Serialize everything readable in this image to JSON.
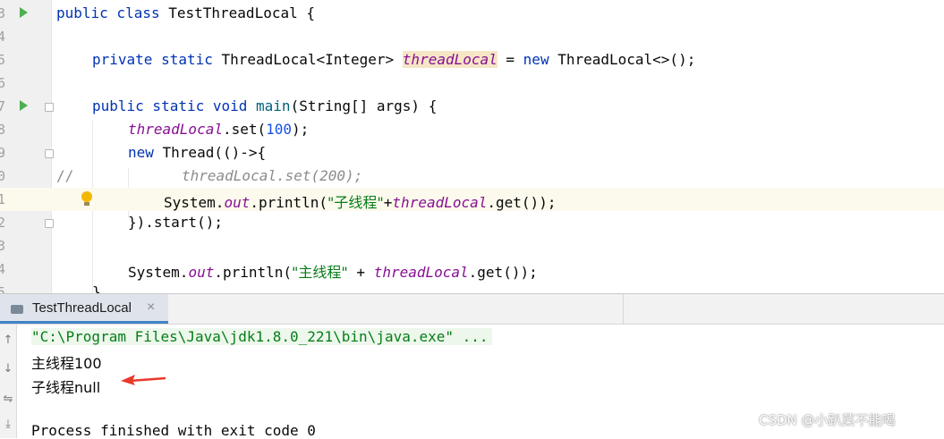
{
  "editor": {
    "lines": [
      {
        "num": "3"
      },
      {
        "num": "4"
      },
      {
        "num": "5"
      },
      {
        "num": "6"
      },
      {
        "num": "7"
      },
      {
        "num": "8"
      },
      {
        "num": "9"
      },
      {
        "num": "0"
      },
      {
        "num": "1"
      },
      {
        "num": "2"
      },
      {
        "num": "3"
      },
      {
        "num": "4"
      },
      {
        "num": "5"
      }
    ],
    "code": {
      "l1_kw": "public class ",
      "l1_rest": "TestThreadLocal {",
      "l3_kw": "private static ",
      "l3_type": "ThreadLocal<Integer> ",
      "l3_field": "threadLocal",
      "l3_eq": " = ",
      "l3_new": "new ",
      "l3_end": "ThreadLocal<>();",
      "l5_kw": "public static void ",
      "l5_fn": "main",
      "l5_rest": "(String[] args) {",
      "l6_field": "threadLocal",
      "l6_mid": ".set(",
      "l6_num": "100",
      "l6_end": ");",
      "l7_new": "new ",
      "l7_rest": "Thread(()->{",
      "l8_slashes": "//",
      "l8_comment": "threadLocal.set(200);",
      "l9_a": "System.",
      "l9_out": "out",
      "l9_b": ".println(",
      "l9_str": "\"子线程\"",
      "l9_plus": "+",
      "l9_field": "threadLocal",
      "l9_end": ".get());",
      "l10": "}).start();",
      "l12_a": "System.",
      "l12_out": "out",
      "l12_b": ".println(",
      "l12_str": "\"主线程\"",
      "l12_plus": " + ",
      "l12_field": "threadLocal",
      "l12_end": ".get());",
      "l13": "}"
    }
  },
  "run_panel": {
    "tab_label": "TestThreadLocal",
    "tab_close": "×",
    "command": "\"C:\\Program Files\\Java\\jdk1.8.0_221\\bin\\java.exe\" ...",
    "out1": "主线程100",
    "out2": "子线程null",
    "exit": "Process finished with exit code 0",
    "icons": [
      "arrow-up-icon",
      "arrow-down-icon",
      "wrap-icon",
      "scroll-end-icon"
    ]
  },
  "colors": {
    "keyword": "#0033b3",
    "field": "#871094",
    "string": "#067d17",
    "number": "#1750eb",
    "comment": "#8c8c8c",
    "annotation_arrow": "#e8392b"
  },
  "watermark": "CSDN @小趴菜不能喝"
}
